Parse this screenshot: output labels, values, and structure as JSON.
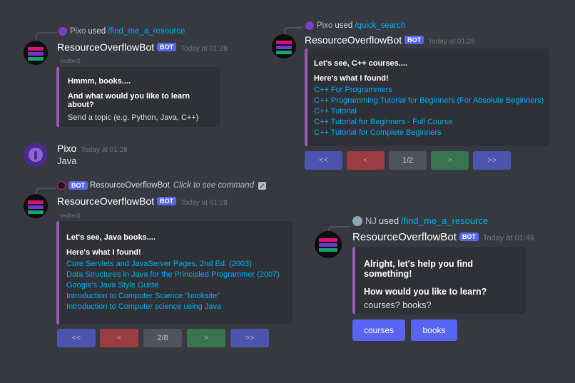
{
  "colors": {
    "background": "#36393f",
    "embed_bg": "#2f3136",
    "embed_accent": "#9b59b6",
    "link": "#00aff4",
    "blurple": "#5865f2",
    "red": "#ed4245",
    "green": "#3ba55d",
    "grey": "#4f545c"
  },
  "msg1": {
    "reply_user": "Pixo",
    "reply_used": "used",
    "reply_command": "/find_me_a_resource",
    "author": "ResourceOverflowBot",
    "bot_tag": "BOT",
    "timestamp": "Today at 01:28",
    "edited": "(edited)",
    "embed": {
      "title": "Hmmm, books....",
      "subtitle": "And what would you like to learn about?",
      "text": "Send a topic (e.g. Python, Java, C++)"
    }
  },
  "msg2": {
    "author": "Pixo",
    "timestamp": "Today at 01:28",
    "text": "Java"
  },
  "msg3": {
    "reply_bot_tag": "BOT",
    "reply_user": "ResourceOverflowBot",
    "reply_hint": "Click to see command",
    "author": "ResourceOverflowBot",
    "bot_tag": "BOT",
    "timestamp": "Today at 01:28",
    "edited": "(edited)",
    "embed": {
      "title": "Let's see, Java books....",
      "subtitle": "Here's what I found!",
      "links": [
        "Core Servlets and JavaServer Pages, 2nd Ed. (2003)",
        "Data Structures in Java for the Principled Programmer (2007)",
        "Google's Java Style Guide",
        "Introduction to Computer Science \"booksite\"",
        "Introduction to Computer science using Java"
      ]
    },
    "buttons": {
      "first": "<<",
      "prev": "<",
      "page": "2/8",
      "next": ">",
      "last": ">>"
    }
  },
  "msg4": {
    "reply_user": "Pixo",
    "reply_used": "used",
    "reply_command": "/quick_search",
    "author": "ResourceOverflowBot",
    "bot_tag": "BOT",
    "timestamp": "Today at 01:28",
    "embed": {
      "title": "Let's see, C++ courses....",
      "subtitle": "Here's what I found!",
      "links": [
        "C++ For Programmers",
        "C++ Programming Tutorial for Beginners (For Absolute Beginners)",
        "C++ Tutorial",
        "C++ Tutorial for Beginners - Full Course",
        "C++ Tutorial for Complete Beginners"
      ]
    },
    "buttons": {
      "first": "<<",
      "prev": "<",
      "page": "1/2",
      "next": ">",
      "last": ">>"
    }
  },
  "msg5": {
    "reply_user": "NJ",
    "reply_used": "used",
    "reply_command": "/find_me_a_resource",
    "author": "ResourceOverflowBot",
    "bot_tag": "BOT",
    "timestamp": "Today at 01:46",
    "embed": {
      "title": "Alright, let's help you find something!",
      "subtitle": "How would you like to learn?",
      "text": "courses? books?"
    },
    "buttons": {
      "courses": "courses",
      "books": "books"
    }
  }
}
